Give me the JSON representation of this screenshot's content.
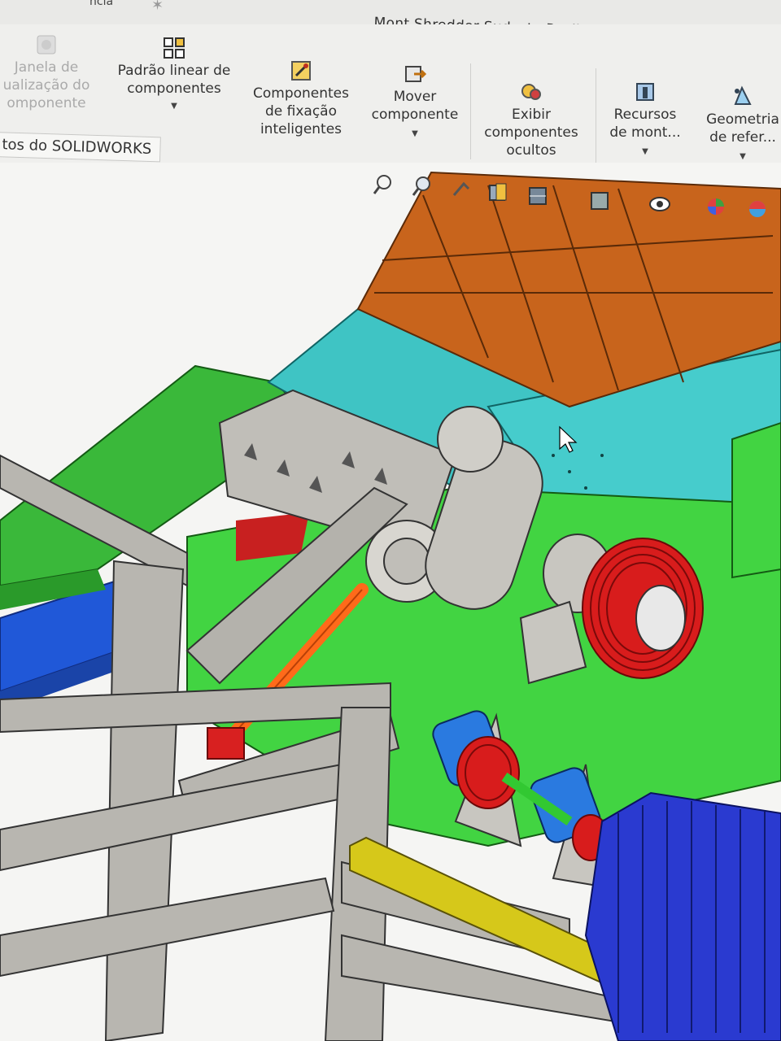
{
  "window": {
    "title": "Mont Shredder Sudeste Paulista *",
    "tab_fragment": "ncia"
  },
  "ribbon": {
    "items": [
      {
        "label_lines": [
          "Janela de",
          "ualização do",
          "omponente"
        ],
        "icon": "component-preview-icon",
        "enabled": false
      },
      {
        "label_lines": [
          "Padrão linear de",
          "componentes"
        ],
        "icon": "linear-pattern-icon",
        "dropdown": true
      },
      {
        "label_lines": [
          "Componentes",
          "de fixação",
          "inteligentes"
        ],
        "icon": "smart-fasteners-icon"
      },
      {
        "label_lines": [
          "Mover",
          "componente"
        ],
        "icon": "move-component-icon",
        "dropdown": true
      },
      {
        "label_lines": [
          "Exibir",
          "componentes",
          "ocultos"
        ],
        "icon": "show-hidden-icon"
      },
      {
        "label_lines": [
          "Recursos",
          "de mont..."
        ],
        "icon": "assembly-features-icon",
        "dropdown": true
      },
      {
        "label_lines": [
          "Geometria",
          "de refer..."
        ],
        "icon": "reference-geometry-icon",
        "dropdown": true
      }
    ]
  },
  "command_tab": {
    "label": "tos do SOLIDWORKS"
  },
  "heads_up_toolbar": {
    "icons": [
      "zoom-to-fit-icon",
      "zoom-area-icon",
      "previous-view-icon",
      "section-view-icon",
      "view-orientation-icon",
      "display-style-icon",
      "hide-show-items-icon",
      "edit-appearance-icon",
      "apply-scene-icon"
    ]
  },
  "colors": {
    "hopper_orange": "#c8641c",
    "housing_teal": "#3fc4c4",
    "frame_green": "#32c832",
    "structure_gray": "#b8b6b0",
    "pulley_red": "#d81c1c",
    "motor_blue": "#2a3ad0",
    "conveyor_blue": "#2058d8",
    "cylinder_orange": "#ff6a1a",
    "bearing_blue": "#2a7ae0",
    "rail_yellow": "#d6c81a"
  }
}
